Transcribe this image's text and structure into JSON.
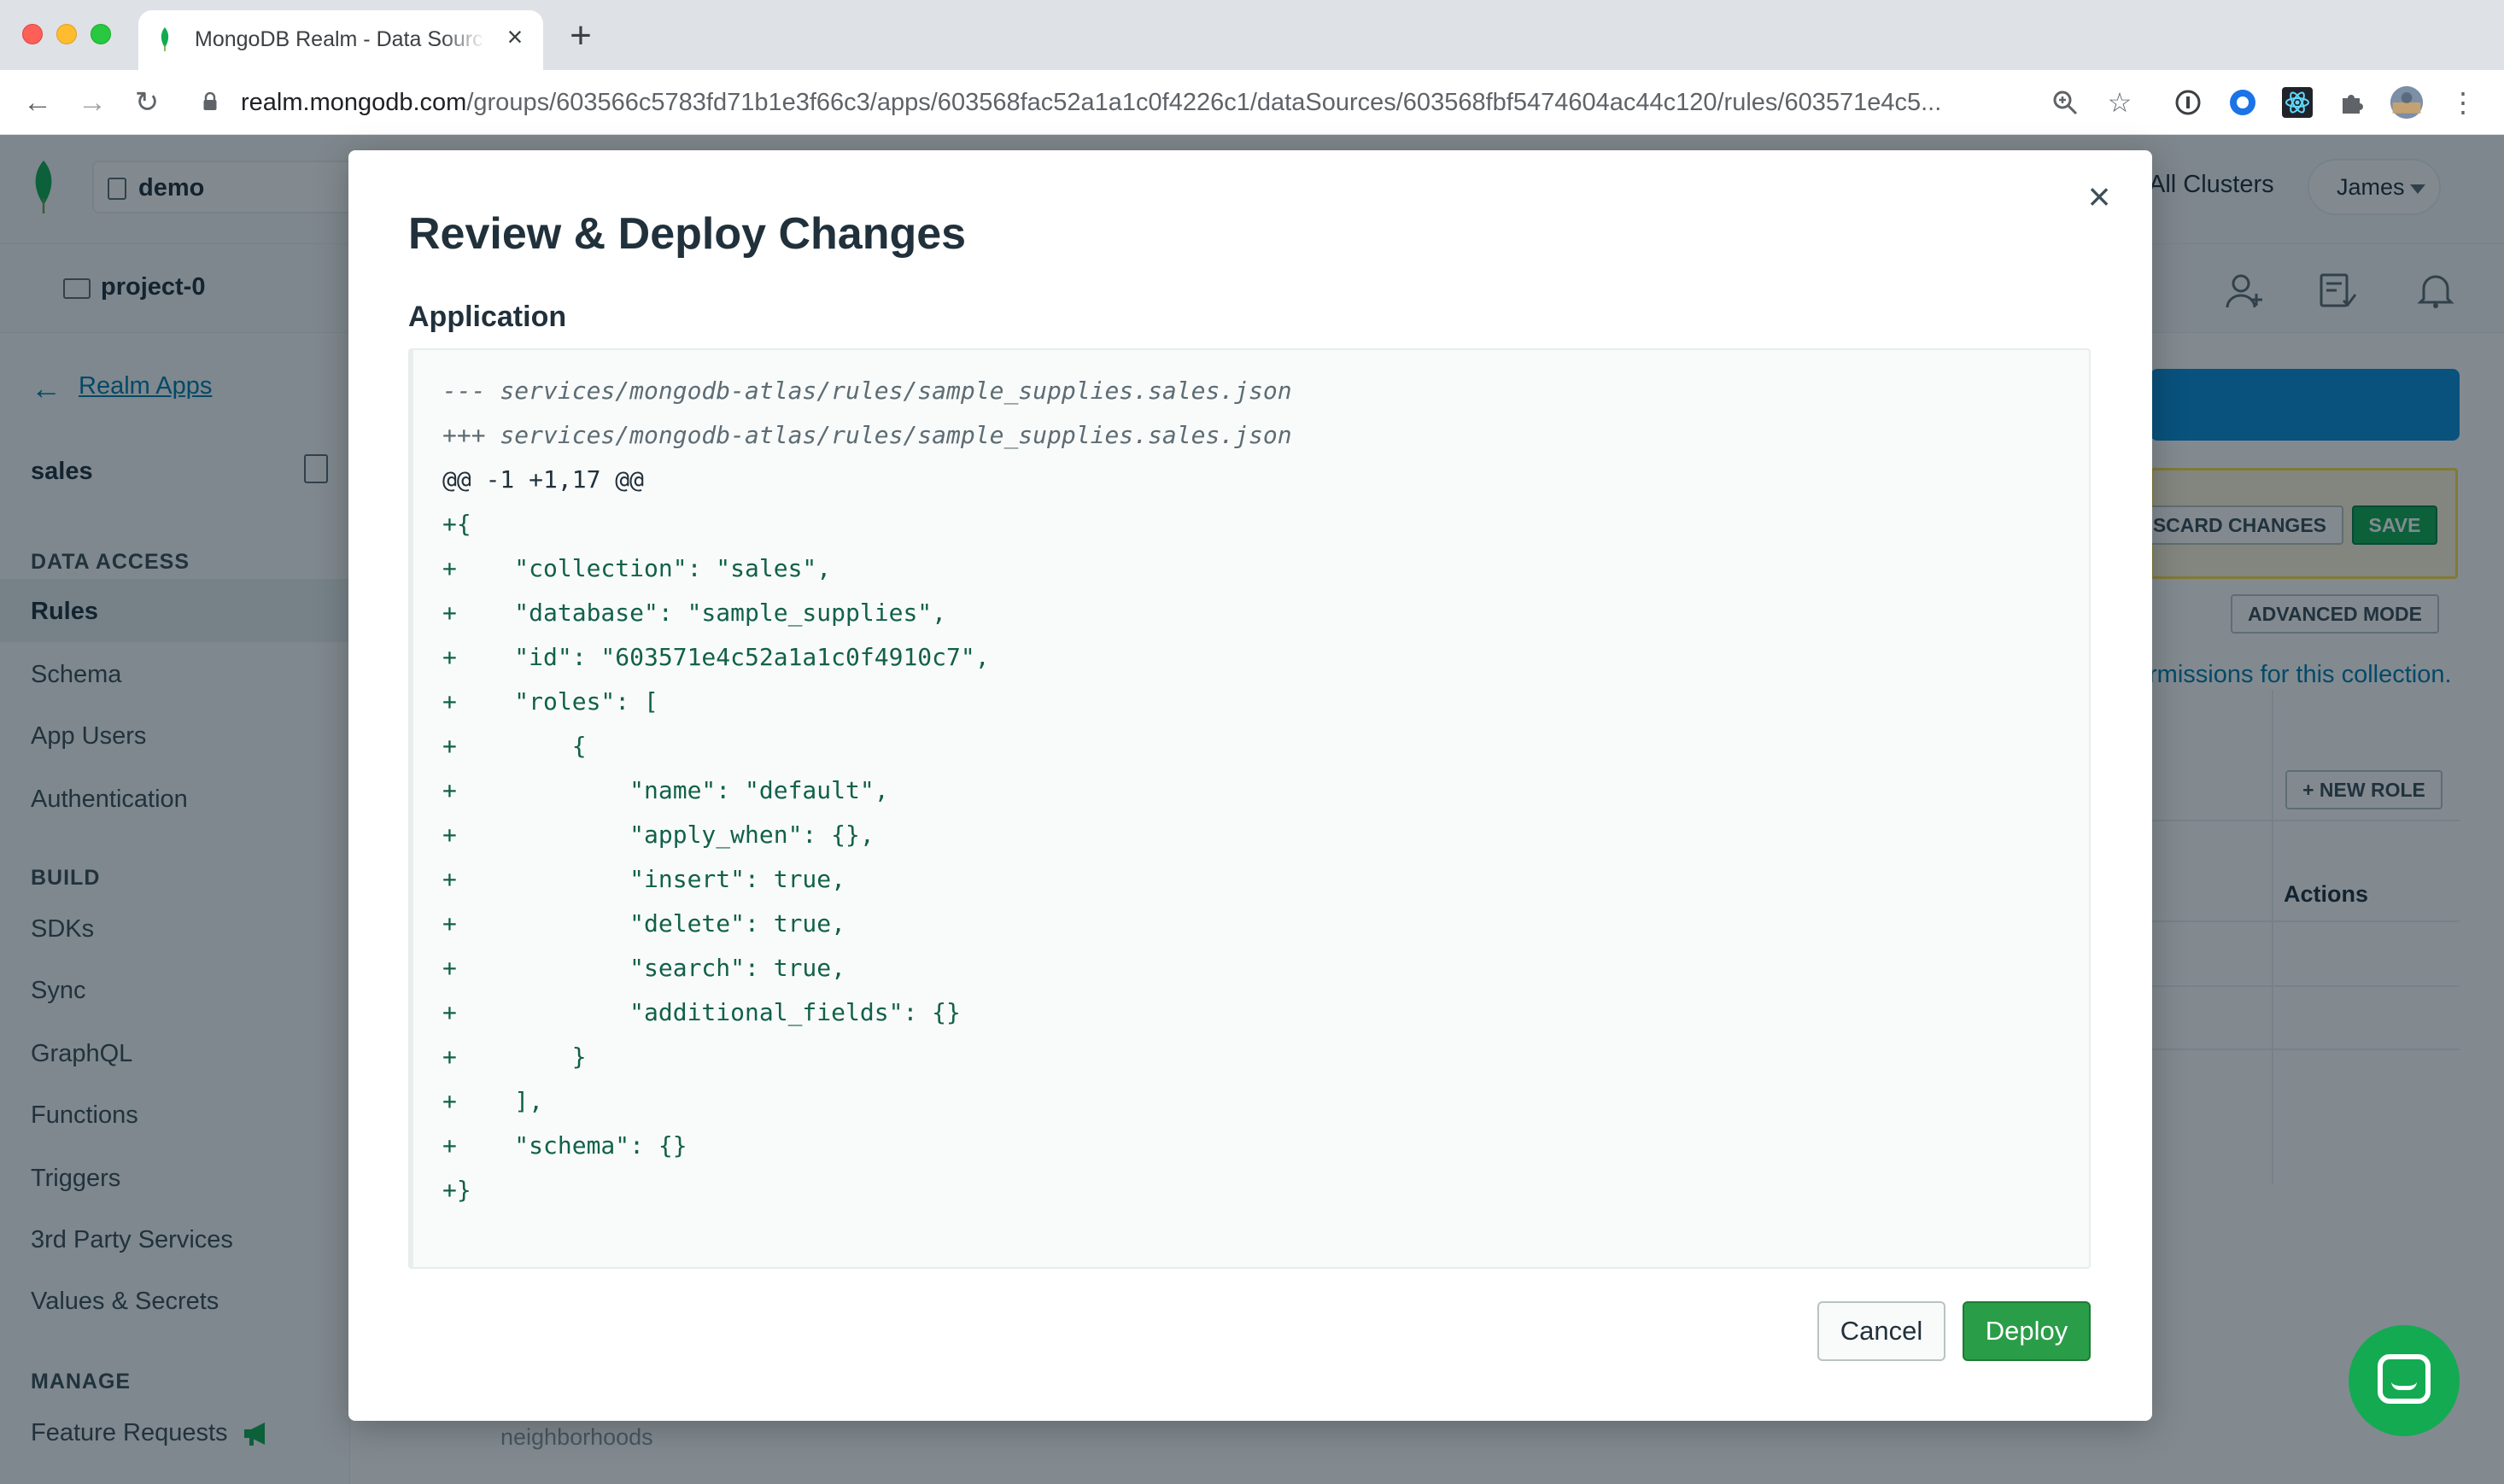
{
  "browser": {
    "tab_title": "MongoDB Realm - Data Sources",
    "tab_close": "×",
    "new_tab": "+",
    "url_domain": "realm.mongodb.com",
    "url_path": "/groups/603566c5783fd71b1e3f66c3/apps/603568fac52a1a1c0f4226c1/dataSources/603568fbf5474604ac44c120/rules/603571e4c5..."
  },
  "app": {
    "org_name": "demo",
    "project_name": "project-0",
    "all_clusters": "All Clusters",
    "user_name": "James",
    "back_link": "Realm Apps",
    "app_name": "sales",
    "sidebar": {
      "data_access_heading": "DATA ACCESS",
      "build_heading": "BUILD",
      "manage_heading": "MANAGE",
      "items": {
        "rules": "Rules",
        "schema": "Schema",
        "app_users": "App Users",
        "authentication": "Authentication",
        "sdks": "SDKs",
        "sync": "Sync",
        "graphql": "GraphQL",
        "functions": "Functions",
        "triggers": "Triggers",
        "third_party": "3rd Party Services",
        "values_secrets": "Values & Secrets",
        "feature_requests": "Feature Requests"
      }
    },
    "discard_changes": "SCARD CHANGES",
    "save": "SAVE",
    "advanced_mode": "ADVANCED MODE",
    "permissions_link": "rmissions for this collection.",
    "new_role": "+ NEW ROLE",
    "actions_header": "Actions",
    "background_text": "neighborhoods"
  },
  "modal": {
    "title": "Review & Deploy Changes",
    "section_label": "Application",
    "close_label": "×",
    "diff_lines": [
      "--- services/mongodb-atlas/rules/sample_supplies.sales.json",
      "+++ services/mongodb-atlas/rules/sample_supplies.sales.json",
      "@@ -1 +1,17 @@",
      "+{",
      "+    \"collection\": \"sales\",",
      "+    \"database\": \"sample_supplies\",",
      "+    \"id\": \"603571e4c52a1a1c0f4910c7\",",
      "+    \"roles\": [",
      "+        {",
      "+            \"name\": \"default\",",
      "+            \"apply_when\": {},",
      "+            \"insert\": true,",
      "+            \"delete\": true,",
      "+            \"search\": true,",
      "+            \"additional_fields\": {}",
      "+        }",
      "+    ],",
      "+    \"schema\": {}",
      "+}"
    ],
    "cancel_label": "Cancel",
    "deploy_label": "Deploy"
  },
  "colors": {
    "deploy_green": "#2a9d48",
    "diff_add": "#116149",
    "link_blue": "#007cad",
    "overlay": "rgba(6,22,33,0.5)"
  }
}
